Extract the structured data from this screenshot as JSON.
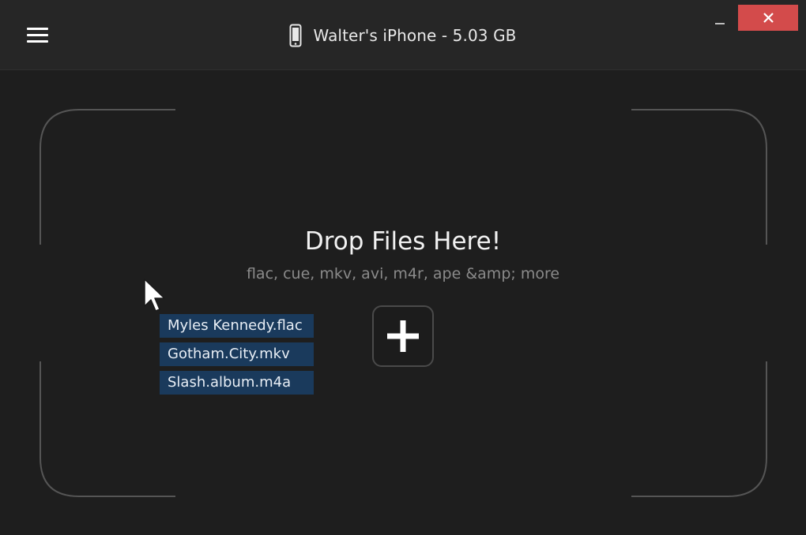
{
  "titlebar": {
    "device_name": "Walter's iPhone - 5.03 GB",
    "close_label": "✕"
  },
  "dropzone": {
    "title": "Drop Files Here!",
    "subtitle": "flac, cue, mkv, avi, m4r, ape &amp; more"
  },
  "files": [
    "Myles Kennedy.flac",
    "Gotham.City.mkv",
    "Slash.album.m4a"
  ],
  "icons": {
    "menu": "hamburger-icon",
    "device": "phone-icon",
    "minimize": "minimize-icon",
    "close": "close-icon",
    "add": "plus-icon",
    "cursor": "mouse-pointer-icon"
  },
  "colors": {
    "background": "#1e1e1e",
    "titlebar": "#262626",
    "close_button": "#d34b4b",
    "file_chip": "#1a3a5c",
    "frame_line": "#555555"
  }
}
